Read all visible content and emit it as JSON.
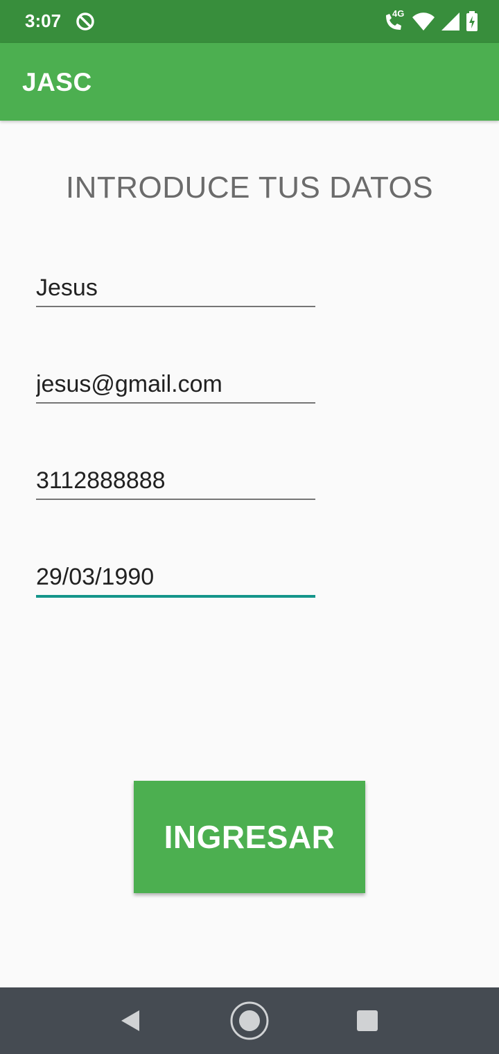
{
  "status_bar": {
    "time": "3:07",
    "network_label": "4G",
    "icons": [
      "sync-disabled-icon",
      "wifi-calling-icon",
      "wifi-icon",
      "cellular-signal-icon",
      "battery-charging-icon"
    ]
  },
  "app_bar": {
    "title": "JASC",
    "color": "#4CAF50"
  },
  "form": {
    "heading": "INTRODUCE TUS DATOS",
    "fields": {
      "name": {
        "value": "Jesus"
      },
      "email": {
        "value": "jesus@gmail.com"
      },
      "phone": {
        "value": "3112888888"
      },
      "birth_date": {
        "value": "29/03/1990"
      }
    },
    "focus_color": "#14958A",
    "submit_label": "INGRESAR"
  },
  "nav_bar": {
    "icons": [
      "back-icon",
      "home-icon",
      "recents-icon"
    ]
  }
}
